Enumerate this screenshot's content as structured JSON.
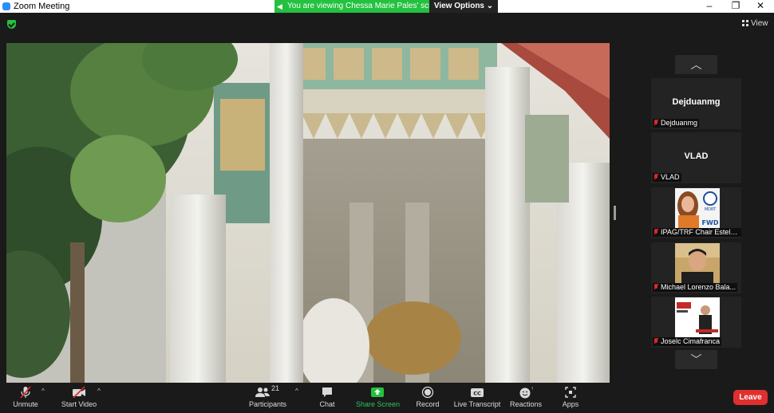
{
  "window": {
    "title": "Zoom Meeting",
    "minimize": "–",
    "maximize": "❐",
    "close": "✕"
  },
  "banner": {
    "text": "You are viewing Chessa Marie Pales' screen",
    "view_options": "View Options ⌄"
  },
  "top": {
    "view_label": "View"
  },
  "gallery": {
    "up": "︿",
    "down": "﹀",
    "tiles": [
      {
        "display_name": "Dejduanmg",
        "label": "Dejduanmg",
        "muted": true,
        "has_video": false
      },
      {
        "display_name": "VLAD",
        "label": "VLAD",
        "muted": true,
        "has_video": false
      },
      {
        "display_name": "",
        "label": "IPAG/TRF Chair Estela...",
        "muted": true,
        "has_video": true
      },
      {
        "display_name": "",
        "label": "Michael Lorenzo Bala...",
        "muted": true,
        "has_video": true
      },
      {
        "display_name": "",
        "label": "Joselc Cimafranca",
        "muted": true,
        "has_video": true
      }
    ],
    "tile_texts": {
      "mdrt": "MDRT",
      "fwd": "FWD"
    }
  },
  "toolbar": {
    "unmute": "Unmute",
    "start_video": "Start Video",
    "participants": "Participants",
    "participants_count": "21",
    "chat": "Chat",
    "share_screen": "Share Screen",
    "record": "Record",
    "live_transcript": "Live Transcript",
    "reactions": "Reactions",
    "apps": "Apps",
    "leave": "Leave",
    "caret": "^"
  },
  "colors": {
    "accent_green": "#23c13f",
    "leave_red": "#e02f2f",
    "muted_red": "#e02828",
    "background": "#1a1a1a"
  }
}
